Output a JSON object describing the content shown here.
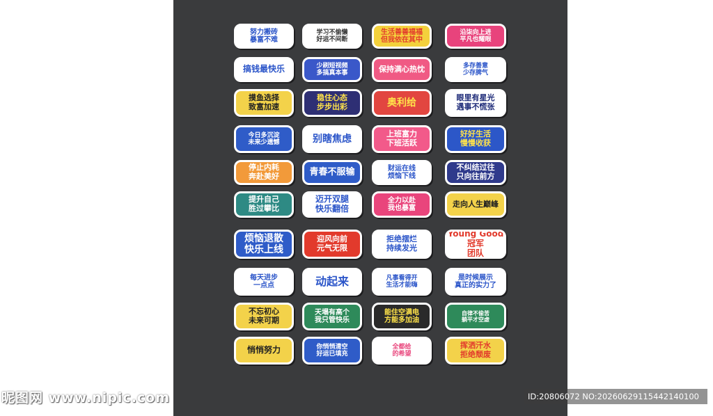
{
  "stickers": [
    {
      "lines": [
        "努力搬砖",
        "暴富不难"
      ],
      "bg": "#ffffff",
      "fg": "#2a54c8",
      "fs": 10
    },
    {
      "lines": [
        "学习不偷懒",
        "好运不间断"
      ],
      "bg": "#ffffff",
      "fg": "#333333",
      "fs": 9
    },
    {
      "lines": [
        "生活善善福福",
        "但我依在其中"
      ],
      "bg": "#f4d13c",
      "fg": "#e23a2c",
      "fs": 10
    },
    {
      "lines": [
        "沿柒向上进",
        "平凡也耀眼"
      ],
      "bg": "#e8437c",
      "fg": "#ffffff",
      "fs": 9
    },
    {
      "lines": [
        "搞钱最快乐"
      ],
      "bg": "#ffffff",
      "fg": "#2b55c9",
      "fs": 12
    },
    {
      "lines": [
        "少刷短视频",
        "多搞真本事"
      ],
      "bg": "#3a58c9",
      "fg": "#ffffff",
      "fs": 9
    },
    {
      "lines": [
        "保持满心热忱"
      ],
      "bg": "#f05a84",
      "fg": "#ffffff",
      "fs": 11
    },
    {
      "lines": [
        "多存善意",
        "少存脾气"
      ],
      "bg": "#ffffff",
      "fg": "#2b55c9",
      "fs": 9
    },
    {
      "lines": [
        "摸鱼选择",
        "致富加速"
      ],
      "bg": "#f3d24a",
      "fg": "#222222",
      "fs": 11
    },
    {
      "lines": [
        "稳住心态",
        "步步出彩"
      ],
      "bg": "#2e2f74",
      "fg": "#ffe34a",
      "fs": 11
    },
    {
      "lines": [
        "奥利给"
      ],
      "bg": "#e24640",
      "fg": "#ffe34a",
      "fs": 14
    },
    {
      "lines": [
        "眼里有星光",
        "遇事不慌张"
      ],
      "bg": "#ffffff",
      "fg": "#1d2a78",
      "fs": 11
    },
    {
      "lines": [
        "今日多沉淀",
        "未来少遗憾"
      ],
      "bg": "#2f5cc8",
      "fg": "#ffffff",
      "fs": 9
    },
    {
      "lines": [
        "别瞎焦虑"
      ],
      "bg": "#ffffff",
      "fg": "#2b55c9",
      "fs": 14
    },
    {
      "lines": [
        "上班富力",
        "下班活跃"
      ],
      "bg": "#f25a8a",
      "fg": "#ffffff",
      "fs": 11
    },
    {
      "lines": [
        "好好生活",
        "慢慢收获"
      ],
      "bg": "#2c57c8",
      "fg": "#ffe34a",
      "fs": 11
    },
    {
      "lines": [
        "停止内耗",
        "奔赴美好"
      ],
      "bg": "#f29a3a",
      "fg": "#ffffff",
      "fs": 11
    },
    {
      "lines": [
        "青春不服输"
      ],
      "bg": "#2f5cc8",
      "fg": "#ffffff",
      "fs": 13
    },
    {
      "lines": [
        "财运在线",
        "烦恼下线"
      ],
      "bg": "#ffffff",
      "fg": "#2b55c9",
      "fs": 10
    },
    {
      "lines": [
        "不纠结过往",
        "只向往前方"
      ],
      "bg": "#2f3a8c",
      "fg": "#ffffff",
      "fs": 11
    },
    {
      "lines": [
        "提升自己",
        "胜过攀比"
      ],
      "bg": "#2e8a84",
      "fg": "#ffffff",
      "fs": 11
    },
    {
      "lines": [
        "迈开双腿",
        "快乐翻倍"
      ],
      "bg": "#ffffff",
      "fg": "#2b55c9",
      "fs": 12
    },
    {
      "lines": [
        "全力以赴",
        "我也暴富"
      ],
      "bg": "#e9457c",
      "fg": "#ffffff",
      "fs": 10
    },
    {
      "lines": [
        "走向人生巅峰"
      ],
      "bg": "#f3d24a",
      "fg": "#222222",
      "fs": 11
    },
    {
      "lines": [
        "烦恼退散",
        "快乐上线"
      ],
      "bg": "#2f5cc8",
      "fg": "#ffffff",
      "fs": 14
    },
    {
      "lines": [
        "迎风向前",
        "元气无限"
      ],
      "bg": "#e23a2c",
      "fg": "#ffffff",
      "fs": 11
    },
    {
      "lines": [
        "拒绝摆烂",
        "持续发光"
      ],
      "bg": "#ffffff",
      "fg": "#2b55c9",
      "fs": 11
    },
    {
      "lines": [
        "Young Good",
        "冠军",
        "团队"
      ],
      "bg": "#ffffff",
      "fg": "#e23a2c",
      "fs": 12
    },
    {
      "lines": [
        "每天进步",
        "一点点"
      ],
      "bg": "#ffffff",
      "fg": "#2b55c9",
      "fs": 10
    },
    {
      "lines": [
        "动起来"
      ],
      "bg": "#ffffff",
      "fg": "#2b55c9",
      "fs": 16
    },
    {
      "lines": [
        "凡事看得开",
        "生活才能嗨"
      ],
      "bg": "#ffffff",
      "fg": "#2b55c9",
      "fs": 9
    },
    {
      "lines": [
        "是时候展示",
        "真正的实力了"
      ],
      "bg": "#ffffff",
      "fg": "#2b55c9",
      "fs": 10
    },
    {
      "lines": [
        "不忘初心",
        "未来可期"
      ],
      "bg": "#f3d24a",
      "fg": "#222222",
      "fs": 11
    },
    {
      "lines": [
        "天塌有高个",
        "我只管快乐"
      ],
      "bg": "#2e8a5a",
      "fg": "#ffffff",
      "fs": 10
    },
    {
      "lines": [
        "能住空满电",
        "方能多加油"
      ],
      "bg": "#2a2a2a",
      "fg": "#ffe34a",
      "fs": 10
    },
    {
      "lines": [
        "自律不偷苦",
        "躺平才空虚"
      ],
      "bg": "#2e8a5a",
      "fg": "#ffffff",
      "fs": 8
    },
    {
      "lines": [
        "悄悄努力"
      ],
      "bg": "#f3d24a",
      "fg": "#222222",
      "fs": 12
    },
    {
      "lines": [
        "你悄悄清空",
        "好运已填充"
      ],
      "bg": "#2f5cc8",
      "fg": "#ffffff",
      "fs": 9
    },
    {
      "lines": [
        "全都给",
        "的希望"
      ],
      "bg": "#ffffff",
      "fg": "#e9457c",
      "fs": 9
    },
    {
      "lines": [
        "挥洒汗水",
        "拒绝颓废"
      ],
      "bg": "#f3d24a",
      "fg": "#e23a2c",
      "fs": 11
    }
  ],
  "watermark_left": "昵图网 www.nipic.com",
  "watermark_right": "ID:20806072 NO:20260629115442140100"
}
